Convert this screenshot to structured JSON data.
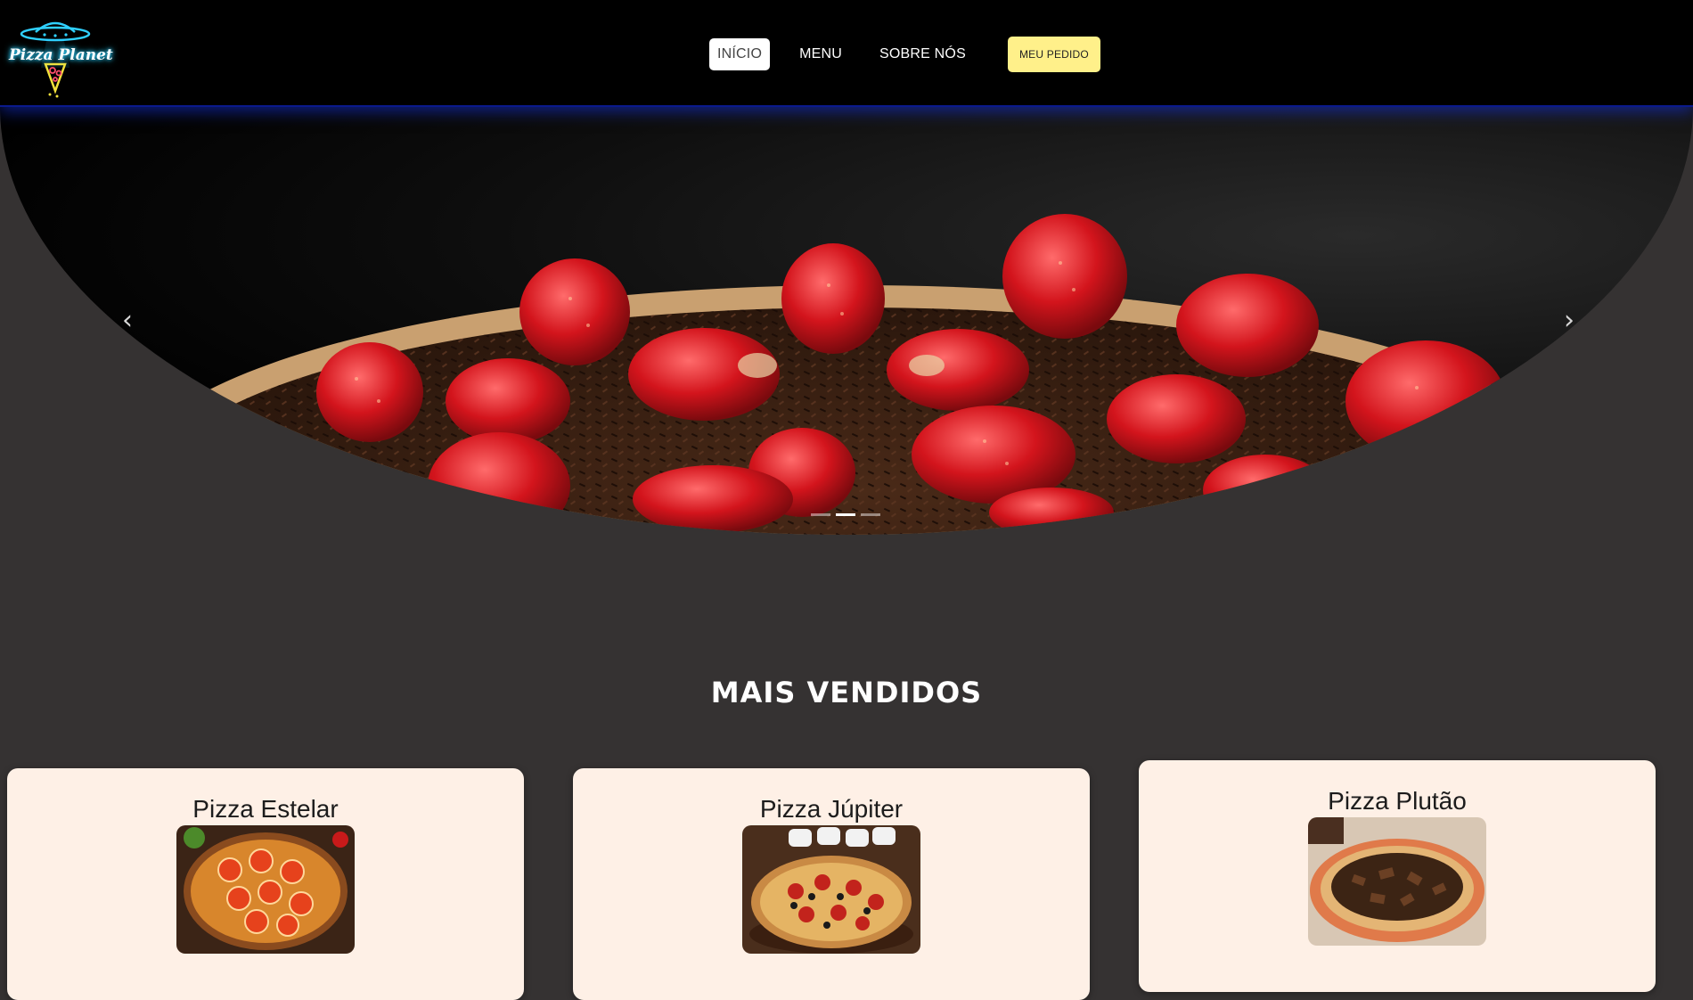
{
  "brand": {
    "logo_text": "Pizza Planet",
    "logo_icon": "ufo-pizza-icon",
    "glow_color": "#2fd0ff"
  },
  "nav": {
    "items": [
      {
        "label": "INÍCIO",
        "active": true
      },
      {
        "label": "MENU",
        "active": false
      },
      {
        "label": "SOBRE NÓS",
        "active": false
      }
    ],
    "order_button": "MEU PEDIDO"
  },
  "carousel": {
    "prev_icon": "chevron-left-icon",
    "next_icon": "chevron-right-icon",
    "slide_count": 3,
    "active_slide": 2,
    "slide_subject": "strawberry-chocolate-pizza-image"
  },
  "best_sellers": {
    "title": "MAIS VENDIDOS",
    "items": [
      {
        "name": "Pizza Estelar",
        "image": "tomato-pizza-image"
      },
      {
        "name": "Pizza Júpiter",
        "image": "pepperoni-olive-pizza-image"
      },
      {
        "name": "Pizza Plutão",
        "image": "chocolate-pizza-image"
      }
    ]
  },
  "colors": {
    "page_background": "#353232",
    "header_background": "#000000",
    "header_glow": "#0a1a8c",
    "order_button": "#fff08a",
    "card_background": "#fef0e6"
  }
}
